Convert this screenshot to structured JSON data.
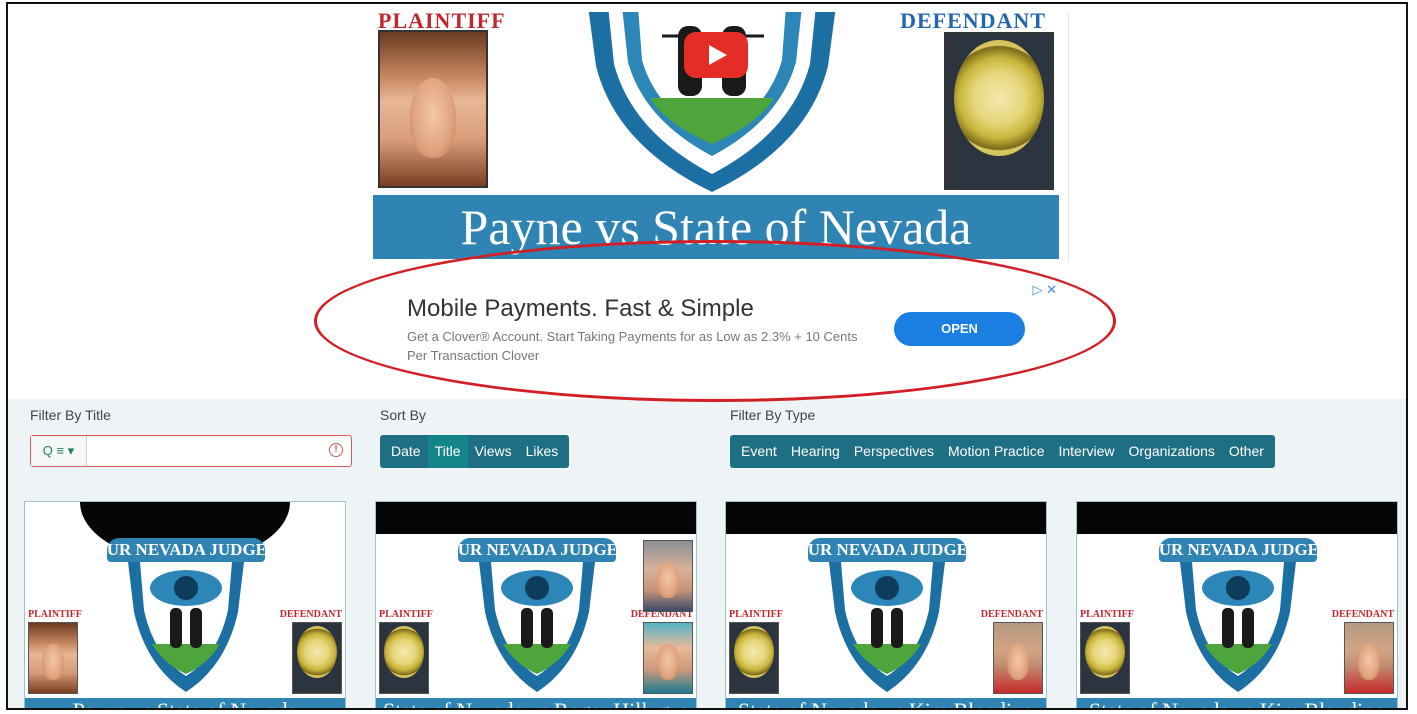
{
  "hero": {
    "plaintiff_label": "PLAINTIFF",
    "defendant_label": "DEFENDANT",
    "banner_title": "Payne vs State of Nevada"
  },
  "ad": {
    "title": "Mobile Payments. Fast & Simple",
    "description": "Get a Clover® Account. Start Taking Payments for as Low as 2.3% + 10 Cents Per Transaction Clover",
    "cta": "OPEN",
    "choices": "▷ ✕"
  },
  "filters": {
    "title_label": "Filter By Title",
    "search_mode": "Q ≡ ▾",
    "search_value": "",
    "sort_label": "Sort By",
    "sort_options": [
      "Date",
      "Title",
      "Views",
      "Likes"
    ],
    "sort_active": "Title",
    "type_label": "Filter By Type",
    "type_options": [
      "Event",
      "Hearing",
      "Perspectives",
      "Motion Practice",
      "Interview",
      "Organizations",
      "Other"
    ]
  },
  "cards": [
    {
      "brand": "OUR NEVADA JUDGES",
      "plaintiff": "PLAINTIFF",
      "defendant": "DEFENDANT",
      "title": "Payne vs State of Nevada"
    },
    {
      "brand": "OUR NEVADA JUDGES",
      "plaintiff": "PLAINTIFF",
      "defendant": "DEFENDANT",
      "title": "State of Nevada vs Roger Hillygus"
    },
    {
      "brand": "OUR NEVADA JUDGES",
      "plaintiff": "PLAINTIFF",
      "defendant": "DEFENDANT",
      "title": "State of Nevada vs Kim Blandino"
    },
    {
      "brand": "OUR NEVADA JUDGES",
      "plaintiff": "PLAINTIFF",
      "defendant": "DEFENDANT",
      "title": "State of Nevada vs Kim Blandino"
    }
  ],
  "colors": {
    "brand_blue": "#2f84b4",
    "teal_button": "#1f6f84",
    "ad_button": "#1a7fe0",
    "highlight_ring": "#d21f26"
  }
}
